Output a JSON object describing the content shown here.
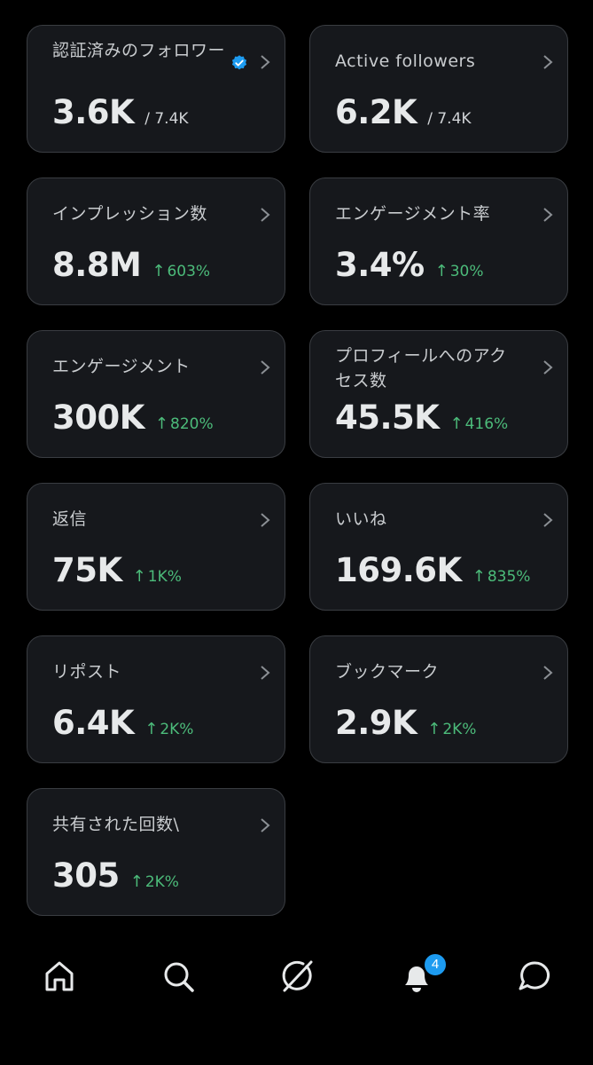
{
  "cards": [
    {
      "label": "認証済みのフォロワー",
      "value": "3.6K",
      "total": "/ 7.4K"
    },
    {
      "label": "Active followers",
      "value": "6.2K",
      "total": "/ 7.4K"
    },
    {
      "label": "インプレッション数",
      "value": "8.8M",
      "delta": "603%"
    },
    {
      "label": "エンゲージメント率",
      "value": "3.4%",
      "delta": "30%"
    },
    {
      "label": "エンゲージメント",
      "value": "300K",
      "delta": "820%"
    },
    {
      "label": "プロフィールへのアクセス数",
      "value": "45.5K",
      "delta": "416%"
    },
    {
      "label": "返信",
      "value": "75K",
      "delta": "1K%"
    },
    {
      "label": "いいね",
      "value": "169.6K",
      "delta": "835%"
    },
    {
      "label": "リポスト",
      "value": "6.4K",
      "delta": "2K%"
    },
    {
      "label": "ブックマーク",
      "value": "2.9K",
      "delta": "2K%"
    },
    {
      "label": "共有された回数\\",
      "value": "305",
      "delta": "2K%"
    }
  ],
  "delta_arrow": "↑",
  "nav": {
    "home_icon": "home-icon",
    "search_icon": "search-icon",
    "grok_icon": "grok-icon",
    "notifications_icon": "bell-icon",
    "notifications_count": "4",
    "messages_icon": "message-icon"
  },
  "colors": {
    "background": "#000000",
    "card": "#16181c",
    "border": "#3a3d42",
    "positive": "#4cbb7a",
    "accent": "#1d9bf0"
  }
}
